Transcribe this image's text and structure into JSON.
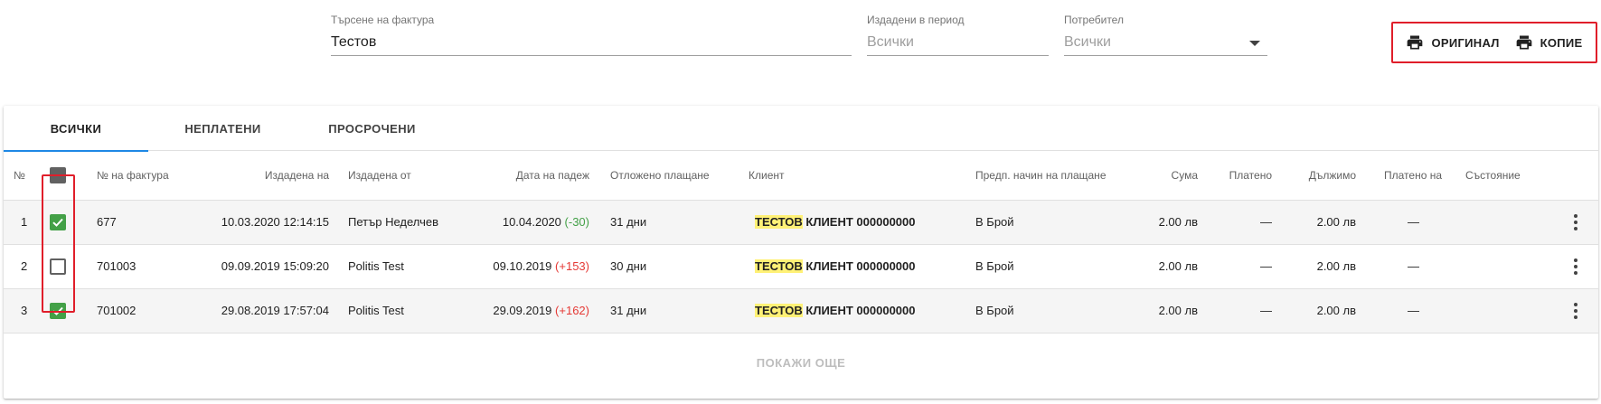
{
  "filters": {
    "search": {
      "label": "Търсене на фактура",
      "value": "Тестов"
    },
    "period": {
      "label": "Издадени в период",
      "placeholder": "Всички"
    },
    "user": {
      "label": "Потребител",
      "placeholder": "Всички"
    }
  },
  "print_buttons": {
    "original": "ОРИГИНАЛ",
    "copy": "КОПИЕ"
  },
  "highlight_color": "#e01e2a",
  "tabs": [
    {
      "label": "ВСИЧКИ",
      "active": true
    },
    {
      "label": "НЕПЛАТЕНИ",
      "active": false
    },
    {
      "label": "ПРОСРОЧЕНИ",
      "active": false
    }
  ],
  "columns": {
    "no": "№",
    "invoice_no": "№ на фактура",
    "issued_on": "Издадена на",
    "issued_by": "Издадена от",
    "due_date": "Дата на падеж",
    "deferred": "Отложено плащане",
    "client": "Клиент",
    "payment_method": "Предп. начин на плащане",
    "amount": "Сума",
    "paid": "Платено",
    "owed": "Дължимо",
    "paid_on": "Платено на",
    "status": "Състояние"
  },
  "rows": [
    {
      "no": "1",
      "checked": true,
      "invoice_no": "677",
      "issued_on": "10.03.2020 12:14:15",
      "issued_by": "Петър Неделчев",
      "due_date": "10.04.2020",
      "due_delta": "(-30)",
      "due_delta_kind": "pos",
      "deferred": "31 дни",
      "client_highlight": "ТЕСТОВ",
      "client_rest": " КЛИЕНТ 000000000",
      "payment_method": "В Брой",
      "amount": "2.00 лв",
      "paid": "—",
      "owed": "2.00 лв",
      "paid_on": "—"
    },
    {
      "no": "2",
      "checked": false,
      "invoice_no": "701003",
      "issued_on": "09.09.2019 15:09:20",
      "issued_by": "Politis Test",
      "due_date": "09.10.2019",
      "due_delta": "(+153)",
      "due_delta_kind": "neg",
      "deferred": "30 дни",
      "client_highlight": "ТЕСТОВ",
      "client_rest": " КЛИЕНТ 000000000",
      "payment_method": "В Брой",
      "amount": "2.00 лв",
      "paid": "—",
      "owed": "2.00 лв",
      "paid_on": "—"
    },
    {
      "no": "3",
      "checked": true,
      "invoice_no": "701002",
      "issued_on": "29.08.2019 17:57:04",
      "issued_by": "Politis Test",
      "due_date": "29.09.2019",
      "due_delta": "(+162)",
      "due_delta_kind": "neg",
      "deferred": "31 дни",
      "client_highlight": "ТЕСТОВ",
      "client_rest": " КЛИЕНТ 000000000",
      "payment_method": "В Брой",
      "amount": "2.00 лв",
      "paid": "—",
      "owed": "2.00 лв",
      "paid_on": "—"
    }
  ],
  "show_more": "ПОКАЖИ ОЩЕ"
}
